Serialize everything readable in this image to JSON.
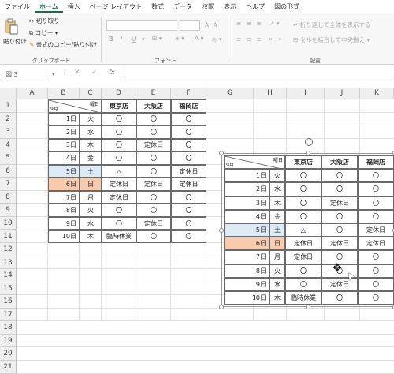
{
  "ribbon": {
    "tabs": [
      "ファイル",
      "ホーム",
      "挿入",
      "ページ レイアウト",
      "数式",
      "データ",
      "校閲",
      "表示",
      "ヘルプ",
      "図の形式"
    ],
    "active_tab": "ホーム",
    "paste_label": "貼り付け",
    "cut_label": "切り取り",
    "copy_label": "コピー",
    "format_painter_label": "書式のコピー/貼り付け",
    "clipboard_group": "クリップボード",
    "font_group": "フォント",
    "alignment_group": "配置",
    "wrap_text_label": "折り返して全体を表示する",
    "merge_label": "セルを結合して中央揃え",
    "bold": "B",
    "italic": "I",
    "underline": "U"
  },
  "formula_bar": {
    "name_box": "図 3",
    "fx": "fx"
  },
  "columns": [
    "A",
    "B",
    "C",
    "D",
    "E",
    "F",
    "G",
    "H",
    "I",
    "J",
    "K"
  ],
  "rows": [
    "1",
    "2",
    "3",
    "4",
    "5",
    "6",
    "7",
    "8",
    "9",
    "10",
    "11",
    "12",
    "13",
    "14",
    "15",
    "16",
    "17",
    "18",
    "19",
    "20",
    "21"
  ],
  "table": {
    "corner_top": "曜日",
    "corner_bottom": "9月",
    "stores": [
      "東京店",
      "大阪店",
      "福岡店"
    ],
    "rows": [
      {
        "day": "1日",
        "dow": "火",
        "v": [
          "〇",
          "〇",
          "〇"
        ]
      },
      {
        "day": "2日",
        "dow": "水",
        "v": [
          "〇",
          "〇",
          "〇"
        ]
      },
      {
        "day": "3日",
        "dow": "木",
        "v": [
          "〇",
          "定休日",
          "〇"
        ]
      },
      {
        "day": "4日",
        "dow": "金",
        "v": [
          "〇",
          "〇",
          "〇"
        ]
      },
      {
        "day": "5日",
        "dow": "土",
        "v": [
          "△",
          "〇",
          "定休日"
        ]
      },
      {
        "day": "6日",
        "dow": "日",
        "v": [
          "定休日",
          "定休日",
          "定休日"
        ]
      },
      {
        "day": "7日",
        "dow": "月",
        "v": [
          "定休日",
          "〇",
          "〇"
        ]
      },
      {
        "day": "8日",
        "dow": "火",
        "v": [
          "〇",
          "〇",
          "〇"
        ]
      },
      {
        "day": "9日",
        "dow": "水",
        "v": [
          "〇",
          "定休日",
          "〇"
        ]
      },
      {
        "day": "10日",
        "dow": "木",
        "v": [
          "臨時休業",
          "〇",
          "〇"
        ]
      }
    ]
  },
  "colors": {
    "saturday": "#ddebf7",
    "sunday": "#f8cbad",
    "accent": "#1e6c41"
  }
}
